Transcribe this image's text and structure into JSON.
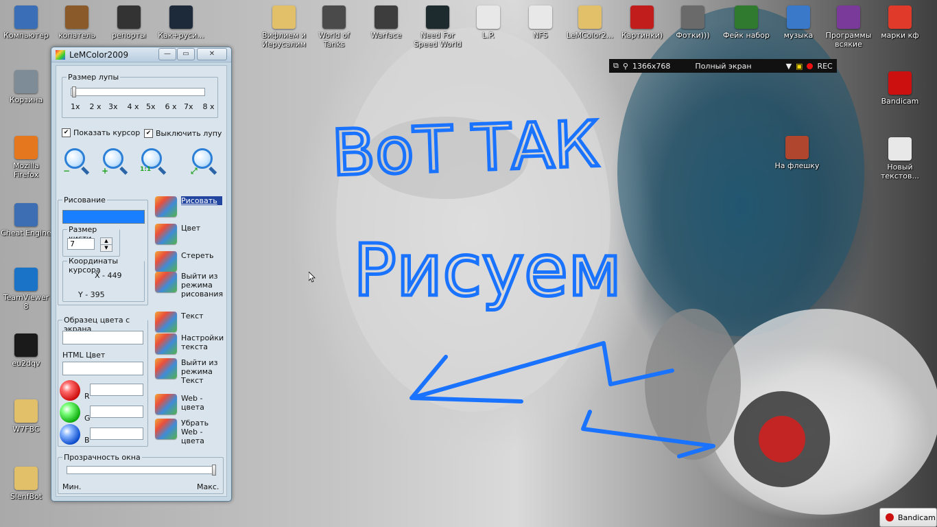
{
  "desktop": {
    "icons": [
      {
        "label": "Компьютер",
        "icon": "computer-icon",
        "color": "#3a6fb7"
      },
      {
        "label": "копатель",
        "icon": "copatel-icon",
        "color": "#8a5a2b"
      },
      {
        "label": "репорты",
        "icon": "film-icon",
        "color": "#333333"
      },
      {
        "label": "Как+руси...",
        "icon": "video-icon",
        "color": "#1d2a3a"
      },
      {
        "label": "Вифлием и Иерусалим",
        "icon": "folder-icon",
        "color": "#e2c06a"
      },
      {
        "label": "World of Tanks",
        "icon": "wot-icon",
        "color": "#4a4a4a"
      },
      {
        "label": "Warface",
        "icon": "warface-icon",
        "color": "#3d3d3d"
      },
      {
        "label": "Need For Speed World",
        "icon": "nfs-icon",
        "color": "#1e2b2e"
      },
      {
        "label": "L.P.",
        "icon": "document-icon",
        "color": "#e8e8e8"
      },
      {
        "label": "NFS",
        "icon": "document-icon",
        "color": "#e8e8e8"
      },
      {
        "label": "LeMColor2...",
        "icon": "folder-icon",
        "color": "#e2c06a"
      },
      {
        "label": "Картинки)",
        "icon": "dice-icon",
        "color": "#c21d1d"
      },
      {
        "label": "Фотки)))",
        "icon": "camera-icon",
        "color": "#6a6a6a"
      },
      {
        "label": "Фейк набор",
        "icon": "fake-icon",
        "color": "#2f7a2f"
      },
      {
        "label": "музыка",
        "icon": "music-icon",
        "color": "#3a79c9"
      },
      {
        "label": "Программы всякие",
        "icon": "archive-icon",
        "color": "#7a3a9a"
      },
      {
        "label": "марки кф",
        "icon": "stamp-icon",
        "color": "#e03b2a"
      },
      {
        "label": "Корзина",
        "icon": "recycle-bin-icon",
        "color": "#7d8c97"
      },
      {
        "label": "Mozilla Firefox",
        "icon": "firefox-icon",
        "color": "#e5781e"
      },
      {
        "label": "Cheat Engine",
        "icon": "cheat-engine-icon",
        "color": "#3d6db3"
      },
      {
        "label": "TeamViewer 8",
        "icon": "teamviewer-icon",
        "color": "#1b73c7"
      },
      {
        "label": "eu2dqv",
        "icon": "phone-icon",
        "color": "#1a1a1a"
      },
      {
        "label": "W7FBC",
        "icon": "folder-icon",
        "color": "#e2c06a"
      },
      {
        "label": "SlenfBot",
        "icon": "folder-icon",
        "color": "#e2c06a"
      },
      {
        "label": "Bandicam",
        "icon": "bandicam-icon",
        "color": "#cc1010"
      },
      {
        "label": "На флешку",
        "icon": "flash-icon",
        "color": "#b0462e"
      },
      {
        "label": "Новый текстов...",
        "icon": "document-icon",
        "color": "#e8e8e8"
      }
    ]
  },
  "bandicam_bar": {
    "resolution": "1366x768",
    "mode": "Полный экран",
    "rec": "REC",
    "rec_color": "#e11111"
  },
  "window": {
    "title": "LeMColor2009",
    "loupe_group": "Размер лупы",
    "loupe_ticks": [
      "1x",
      "2 x",
      "3x",
      "4 x",
      "5x",
      "6 x",
      "7x",
      "8 x"
    ],
    "show_cursor": "Показать курсор",
    "disable_loupe": "Выключить лупу",
    "drawing_group": "Рисование",
    "drawing_color": "#1a7fff",
    "brush_group": "Размер кисти",
    "brush_value": "7",
    "coords_group": "Координаты курсора",
    "coord_x": "X - 449",
    "coord_y": "Y - 395",
    "sample_group": "Образец цвета с экрана",
    "html_color": "HTML Цвет",
    "r_label": "R",
    "g_label": "G",
    "b_label": "B",
    "actions": [
      "Рисовать",
      "Цвет",
      "Стереть",
      "Выйти из режима рисования",
      "Текст",
      "Настройки текста",
      "Выйти из режима Текст",
      "Web - цвета",
      "Убрать Web - цвета"
    ],
    "opacity_group": "Прозрачность окна",
    "min_label": "Мин.",
    "max_label": "Макс."
  },
  "drawing_text": {
    "line1": "ВоТ ТАК",
    "line2": "Рисуем",
    "ink_color": "#1a73ff"
  },
  "taskbar": {
    "bandicam": "Bandicam"
  }
}
